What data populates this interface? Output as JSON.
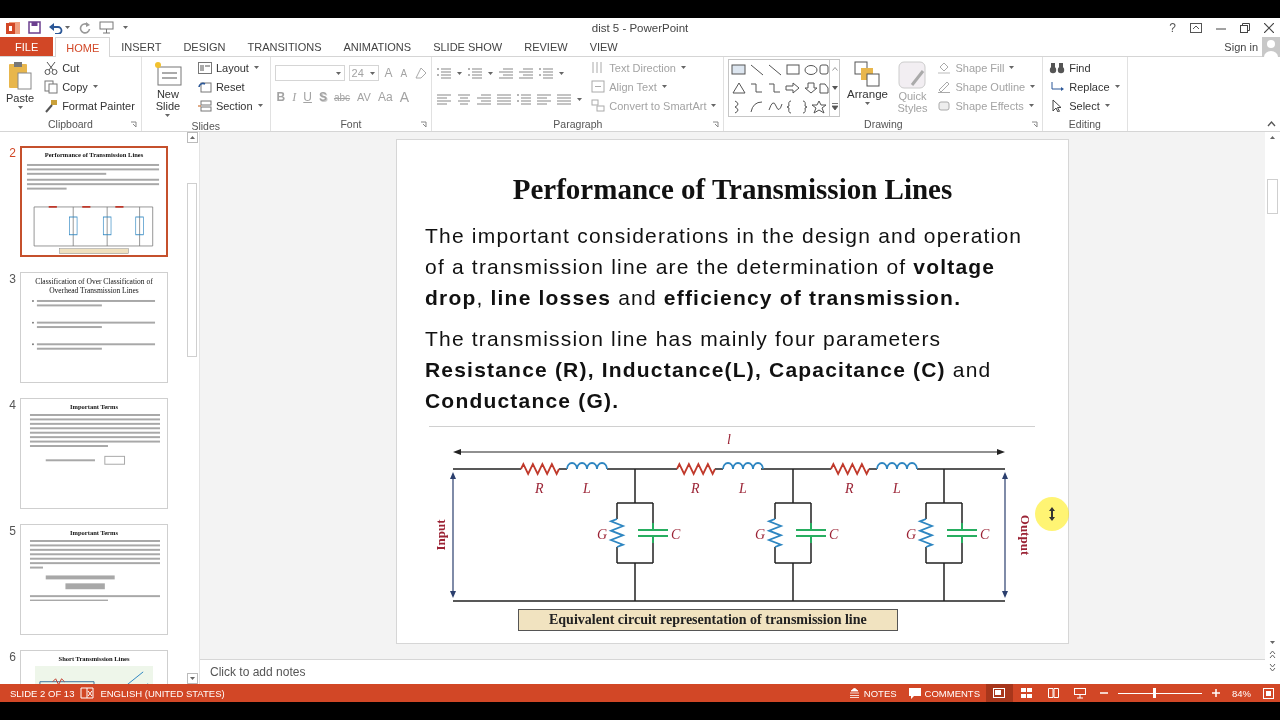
{
  "window": {
    "title": "dist 5 - PowerPoint",
    "help": "?",
    "sign_in": "Sign in"
  },
  "tabs": [
    {
      "label": "FILE",
      "kind": "file",
      "selected": false
    },
    {
      "label": "HOME",
      "kind": "tab",
      "selected": true
    },
    {
      "label": "INSERT",
      "kind": "tab",
      "selected": false
    },
    {
      "label": "DESIGN",
      "kind": "tab",
      "selected": false
    },
    {
      "label": "TRANSITIONS",
      "kind": "tab",
      "selected": false
    },
    {
      "label": "ANIMATIONS",
      "kind": "tab",
      "selected": false
    },
    {
      "label": "SLIDE SHOW",
      "kind": "tab",
      "selected": false
    },
    {
      "label": "REVIEW",
      "kind": "tab",
      "selected": false
    },
    {
      "label": "VIEW",
      "kind": "tab",
      "selected": false
    }
  ],
  "ribbon": {
    "clipboard": {
      "label": "Clipboard",
      "paste": "Paste",
      "cut": "Cut",
      "copy": "Copy",
      "format_painter": "Format Painter"
    },
    "slides": {
      "label": "Slides",
      "new_slide": "New Slide",
      "layout": "Layout",
      "reset": "Reset",
      "section": "Section"
    },
    "font": {
      "label": "Font",
      "disabled": true,
      "size": "24",
      "grow": "A",
      "shrink": "A",
      "styles": [
        "B",
        "I",
        "U",
        "S",
        "abc",
        "AV",
        "Aa",
        "A"
      ]
    },
    "paragraph": {
      "label": "Paragraph",
      "disabled": true,
      "text_direction": "Text Direction",
      "align_text": "Align Text",
      "convert": "Convert to SmartArt"
    },
    "drawing": {
      "label": "Drawing",
      "arrange": "Arrange",
      "quick_styles": "Quick Styles",
      "shape_fill": "Shape Fill",
      "shape_outline": "Shape Outline",
      "shape_effects": "Shape Effects",
      "disabled": true
    },
    "editing": {
      "label": "Editing",
      "find": "Find",
      "replace": "Replace",
      "select": "Select"
    }
  },
  "thumbnails": [
    {
      "number": "2",
      "selected": true,
      "kind": "circuit",
      "title": "Performance of Transmission Lines"
    },
    {
      "number": "3",
      "selected": false,
      "kind": "bullets",
      "title": "Classification of Over Classification of Overhead Transmission Lines"
    },
    {
      "number": "4",
      "selected": false,
      "kind": "text",
      "title": "Important Terms"
    },
    {
      "number": "5",
      "selected": false,
      "kind": "formula",
      "title": "Important Terms"
    },
    {
      "number": "6",
      "selected": false,
      "kind": "diagram",
      "title": "Short Transmission Lines"
    }
  ],
  "slide": {
    "title": "Performance of Transmission Lines",
    "paragraphs": [
      "The important considerations in the design and operation of a transmission line are the determination of **voltage drop**, **line losses** and **efficiency of transmission.**",
      "The transmission line has mainly four parameters **Resistance (R), Inductance(L), Capacitance (C)** and **Conductance (G).**"
    ],
    "circuit": {
      "length_label": "l",
      "input_label": "Input",
      "output_label": "Output",
      "sections": [
        {
          "r": "R",
          "l": "L",
          "g": "G",
          "c": "C"
        },
        {
          "r": "R",
          "l": "L",
          "g": "G",
          "c": "C"
        },
        {
          "r": "R",
          "l": "L",
          "g": "G",
          "c": "C"
        }
      ],
      "caption": "Equivalent circuit representation of transmission line"
    }
  },
  "notes": {
    "placeholder": "Click to add notes"
  },
  "status_bar": {
    "slide": "SLIDE 2 OF 13",
    "language": "ENGLISH (UNITED STATES)",
    "notes": "NOTES",
    "comments": "COMMENTS",
    "views": [
      {
        "selected": true
      },
      {
        "selected": false
      },
      {
        "selected": false
      },
      {
        "selected": false
      }
    ],
    "zoom": {
      "level": 0.43,
      "reading": "84%"
    }
  }
}
